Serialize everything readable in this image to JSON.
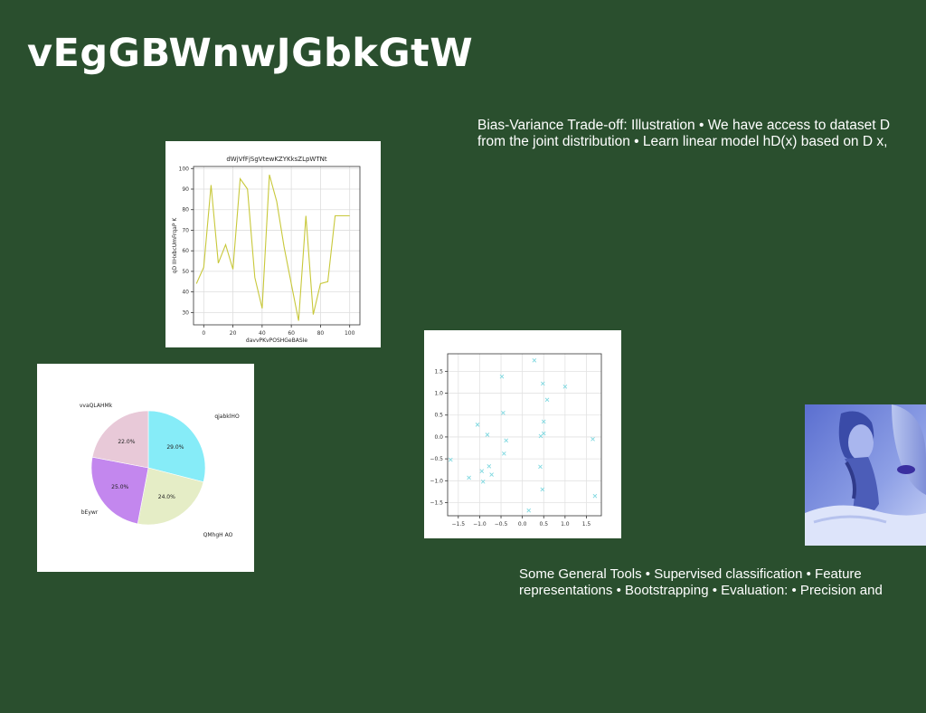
{
  "slide": {
    "title": "vEgGBWnwJGbkGtW",
    "text_top": {
      "line1": "Bias-Variance Trade-off: Illustration • We have access to dataset D",
      "line2": "from the joint distribution • Learn linear model hD(x) based on D x,"
    },
    "text_bottom": {
      "line1": "Some General Tools • Supervised classification • Feature",
      "line2": "representations • Bootstrapping • Evaluation: • Precision and"
    },
    "photo_icon": "person-photo"
  },
  "chart_data": [
    {
      "type": "line",
      "title": "dWjVfFjSgVtewKZYKksZLpWTNt",
      "xlabel": "davvPKvPOSHGeBASIe",
      "ylabel": "qD IIHxbcUmFrqaP K",
      "color": "#c8c83a",
      "xlim": [
        -7,
        107
      ],
      "ylim": [
        24,
        101
      ],
      "xticks": [
        0,
        20,
        40,
        60,
        80,
        100
      ],
      "yticks": [
        30,
        40,
        50,
        60,
        70,
        80,
        90,
        100
      ],
      "grid": true,
      "x": [
        -5,
        0,
        5,
        10,
        15,
        20,
        25,
        30,
        35,
        40,
        45,
        50,
        55,
        60,
        65,
        70,
        75,
        80,
        85,
        90,
        95,
        100
      ],
      "y": [
        44,
        52,
        92,
        54,
        63,
        51,
        95,
        90,
        47,
        32,
        97,
        84,
        62,
        44,
        26,
        77,
        29,
        44,
        45,
        77,
        77,
        77
      ]
    },
    {
      "type": "pie",
      "labels": [
        "qjabklHO",
        "QMhgH AO",
        "bEywr",
        "vvaQLAHMk"
      ],
      "values": [
        29.0,
        24.0,
        25.0,
        22.0
      ],
      "pct_labels": [
        "29.0%",
        "24.0%",
        "25.0%",
        "22.0%"
      ],
      "colors": [
        "#86ecf8",
        "#e5edc6",
        "#c387ee",
        "#e8c9d8"
      ]
    },
    {
      "type": "scatter",
      "marker": "x",
      "color": "#7fd8e0",
      "xlim": [
        -1.75,
        1.85
      ],
      "ylim": [
        -1.8,
        1.9
      ],
      "xticks": [
        -1.5,
        -1.0,
        -0.5,
        0.0,
        0.5,
        1.0,
        1.5
      ],
      "xtick_labels": [
        "−1.5",
        "−1.0",
        "−0.5",
        "0.0",
        "0.5",
        "1.0",
        "1.5"
      ],
      "yticks": [
        -1.5,
        -1.0,
        -0.5,
        0.0,
        0.5,
        1.0,
        1.5
      ],
      "ytick_labels": [
        "−1.5",
        "−1.0",
        "−0.5",
        "0.0",
        "0.5",
        "1.0",
        "1.5"
      ],
      "grid": true,
      "points": [
        [
          -1.68,
          -0.52
        ],
        [
          -1.25,
          -0.93
        ],
        [
          -1.05,
          0.28
        ],
        [
          -0.95,
          -0.78
        ],
        [
          -0.92,
          -1.02
        ],
        [
          -0.82,
          0.05
        ],
        [
          -0.78,
          -0.67
        ],
        [
          -0.72,
          -0.86
        ],
        [
          -0.48,
          1.38
        ],
        [
          -0.45,
          0.55
        ],
        [
          -0.43,
          -0.38
        ],
        [
          -0.38,
          -0.08
        ],
        [
          0.15,
          -1.68
        ],
        [
          0.28,
          1.75
        ],
        [
          0.42,
          -0.68
        ],
        [
          0.43,
          0.02
        ],
        [
          0.47,
          -1.2
        ],
        [
          0.48,
          1.22
        ],
        [
          0.5,
          0.35
        ],
        [
          0.5,
          0.08
        ],
        [
          0.58,
          0.85
        ],
        [
          1.0,
          1.15
        ],
        [
          1.65,
          -0.05
        ],
        [
          1.7,
          -1.35
        ]
      ]
    }
  ]
}
